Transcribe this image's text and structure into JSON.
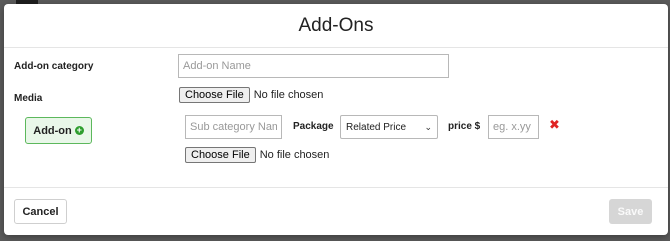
{
  "modal": {
    "title": "Add-Ons",
    "category_label": "Add-on category",
    "category_placeholder": "Add-on Name",
    "media_label": "Media",
    "media_file": {
      "button": "Choose File",
      "status": "No file chosen"
    },
    "addon_button": "Add-on",
    "row": {
      "sub_placeholder": "Sub category Name",
      "package_label": "Package",
      "package_selected": "Related Price",
      "price_label": "price $",
      "price_placeholder": "eg. x.yy",
      "file": {
        "button": "Choose File",
        "status": "No file chosen"
      }
    },
    "cancel_label": "Cancel",
    "save_label": "Save"
  },
  "icons": {
    "plus": "plus-circle-icon",
    "remove": "close-icon",
    "chevron": "chevron-down-icon"
  },
  "colors": {
    "addon_border": "#5cb85c",
    "addon_bg": "#e9f7e9",
    "plus": "#2e9e2e",
    "remove": "#e02424",
    "save_disabled": "#d6d6d6"
  }
}
